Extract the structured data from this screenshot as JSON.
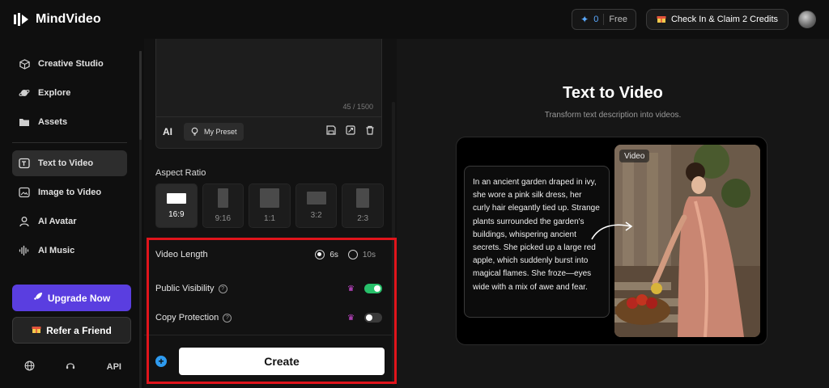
{
  "app": {
    "name": "MindVideo"
  },
  "topbar": {
    "credits_value": "0",
    "credits_plan": "Free",
    "checkin_label": "Check In & Claim 2 Credits"
  },
  "sidebar": {
    "items": [
      {
        "label": "Creative Studio",
        "icon": "cube-icon"
      },
      {
        "label": "Explore",
        "icon": "planet-icon"
      },
      {
        "label": "Assets",
        "icon": "folder-icon"
      },
      {
        "label": "Text to Video",
        "icon": "text-video-icon",
        "active": true
      },
      {
        "label": "Image to Video",
        "icon": "image-icon"
      },
      {
        "label": "AI Avatar",
        "icon": "person-icon"
      },
      {
        "label": "AI Music",
        "icon": "soundwave-icon"
      }
    ],
    "upgrade_label": "Upgrade Now",
    "refer_label": "Refer a Friend",
    "footer_api": "API"
  },
  "prompt": {
    "char_count": "45 / 1500",
    "ai_label": "AI",
    "preset_label": "My Preset"
  },
  "aspect_ratio": {
    "title": "Aspect Ratio",
    "options": [
      "16:9",
      "9:16",
      "1:1",
      "3:2",
      "2:3"
    ],
    "selected": "16:9"
  },
  "settings": {
    "video_length_label": "Video Length",
    "length_options": [
      "6s",
      "10s"
    ],
    "length_selected": "6s",
    "public_visibility_label": "Public Visibility",
    "public_visibility_on": true,
    "copy_protection_label": "Copy Protection",
    "copy_protection_on": false,
    "help_symbol": "?"
  },
  "create_label": "Create",
  "hero": {
    "title": "Text to Video",
    "subtitle": "Transform text description into videos."
  },
  "demo": {
    "text": "In an ancient garden draped in ivy, she wore a pink silk dress, her curly hair elegantly tied up. Strange plants surrounded the garden's buildings, whispering ancient secrets. She picked up a large red apple, which suddenly burst into magical flames. She froze—eyes wide with a mix of awe and fear.",
    "badge": "Video"
  },
  "colors": {
    "accent_purple": "#5a3ee0",
    "toggle_on": "#27c06a",
    "highlight_red": "#e0141b",
    "credit_blue": "#5aa9ff"
  }
}
